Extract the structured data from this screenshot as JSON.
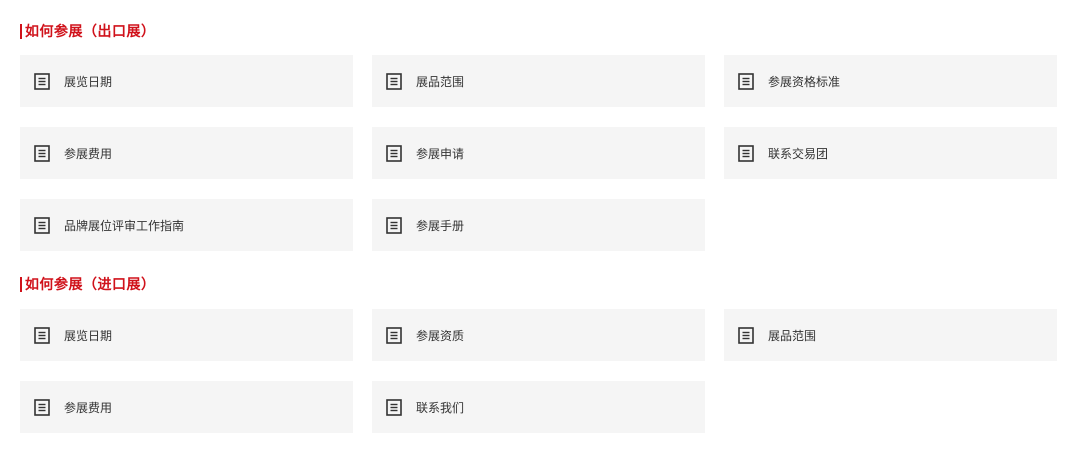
{
  "sections": [
    {
      "title": "如何参展（出口展）",
      "items": [
        {
          "label": "展览日期",
          "icon": "document-icon"
        },
        {
          "label": "展品范围",
          "icon": "document-icon"
        },
        {
          "label": "参展资格标准",
          "icon": "document-icon"
        },
        {
          "label": "参展费用",
          "icon": "document-icon"
        },
        {
          "label": "参展申请",
          "icon": "document-icon"
        },
        {
          "label": "联系交易团",
          "icon": "document-icon"
        },
        {
          "label": "品牌展位评审工作指南",
          "icon": "document-icon"
        },
        {
          "label": "参展手册",
          "icon": "document-icon"
        }
      ]
    },
    {
      "title": "如何参展（进口展）",
      "items": [
        {
          "label": "展览日期",
          "icon": "document-icon"
        },
        {
          "label": "参展资质",
          "icon": "document-icon"
        },
        {
          "label": "展品范围",
          "icon": "document-icon"
        },
        {
          "label": "参展费用",
          "icon": "document-icon"
        },
        {
          "label": "联系我们",
          "icon": "document-icon"
        }
      ]
    }
  ],
  "colors": {
    "accent": "#d0121b",
    "card_background": "#f5f5f5",
    "text": "#333333"
  }
}
